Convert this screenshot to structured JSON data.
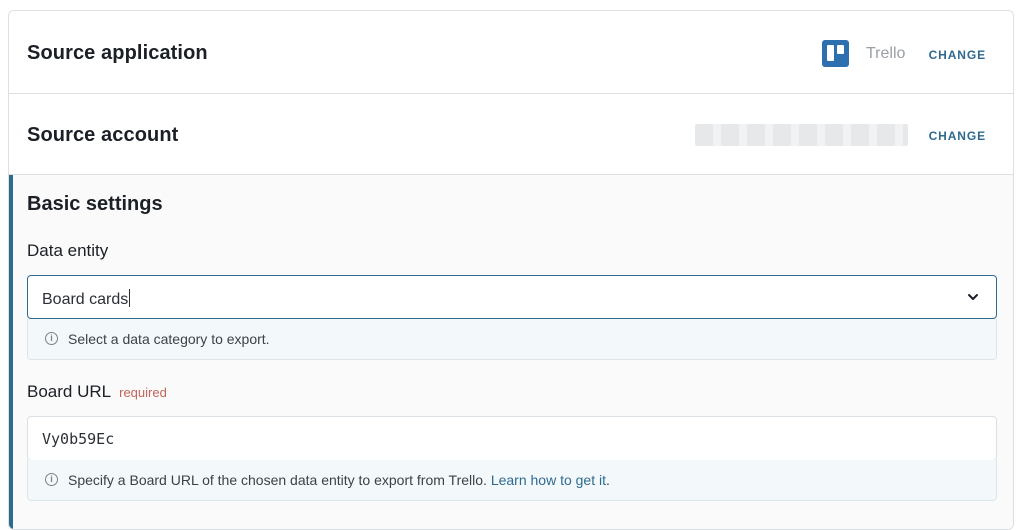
{
  "source_application": {
    "title": "Source application",
    "app_name": "Trello",
    "change_label": "CHANGE"
  },
  "source_account": {
    "title": "Source account",
    "change_label": "CHANGE"
  },
  "basic_settings": {
    "title": "Basic settings",
    "data_entity": {
      "label": "Data entity",
      "value": "Board cards",
      "hint": "Select a data category to export."
    },
    "board_url": {
      "label": "Board URL",
      "required_label": "required",
      "value": "Vy0b59Ec",
      "hint": "Specify a Board URL of the chosen data entity to export from Trello.",
      "hint_link": "Learn how to get it",
      "hint_suffix": "."
    }
  },
  "icons": {
    "trello": "trello-logo-icon",
    "info": "info-icon",
    "chevron": "chevron-down-icon"
  },
  "colors": {
    "accent": "#2f6a8f",
    "trello_blue": "#2e6fb0",
    "required": "#c0655a"
  }
}
